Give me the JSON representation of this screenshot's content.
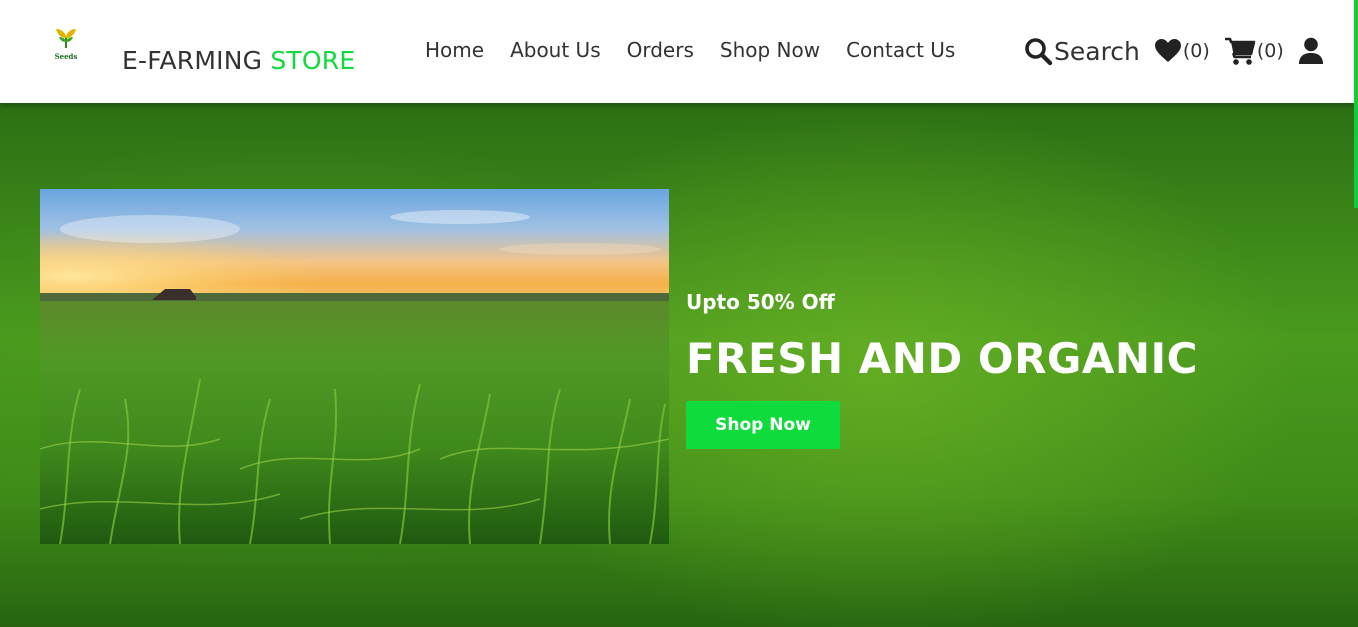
{
  "header": {
    "logo_caption": "Seeds",
    "brand_prefix": "E-FARMING ",
    "brand_accent": "STORE",
    "nav": [
      {
        "label": "Home"
      },
      {
        "label": "About Us"
      },
      {
        "label": "Orders"
      },
      {
        "label": "Shop Now"
      },
      {
        "label": "Contact Us"
      }
    ],
    "search_label": "Search",
    "wishlist_count": "(0)",
    "cart_count": "(0)"
  },
  "hero": {
    "offer": "Upto 50% Off",
    "headline": "FRESH AND ORGANIC",
    "cta_label": "Shop Now"
  },
  "colors": {
    "accent": "#0fdc3c",
    "header_bg": "#ffffff",
    "hero_green": "#3f8b18",
    "text_dark": "#333333"
  },
  "icons": [
    "logo-sprout-icon",
    "search-icon",
    "heart-icon",
    "cart-icon",
    "user-icon"
  ]
}
